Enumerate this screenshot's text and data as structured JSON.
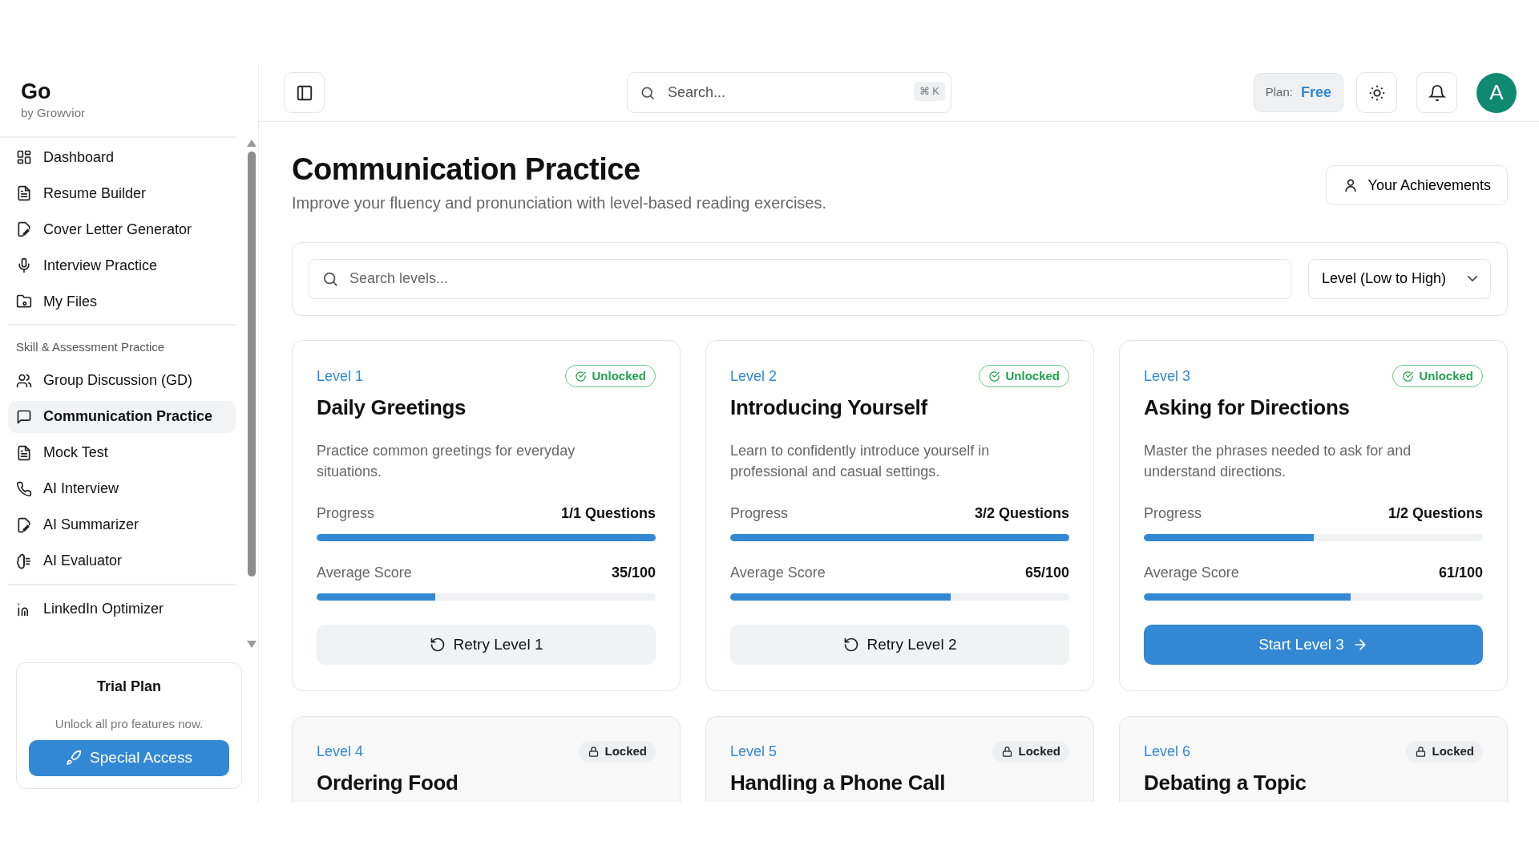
{
  "brand": {
    "name": "Go",
    "tagline": "by Growvior"
  },
  "sidebar": {
    "groups": [
      {
        "items": [
          {
            "label": "Dashboard",
            "selected": false
          },
          {
            "label": "Resume Builder",
            "selected": false
          },
          {
            "label": "Cover Letter Generator",
            "selected": false
          },
          {
            "label": "Interview Practice",
            "selected": false
          },
          {
            "label": "My Files",
            "selected": false
          }
        ]
      },
      {
        "heading": "Skill & Assessment Practice",
        "items": [
          {
            "label": "Group Discussion (GD)",
            "selected": false
          },
          {
            "label": "Communication Practice",
            "selected": true
          },
          {
            "label": "Mock Test",
            "selected": false
          },
          {
            "label": "AI Interview",
            "selected": false
          },
          {
            "label": "AI Summarizer",
            "selected": false
          },
          {
            "label": "AI Evaluator",
            "selected": false
          }
        ]
      },
      {
        "items": [
          {
            "label": "LinkedIn Optimizer",
            "selected": false
          }
        ]
      }
    ]
  },
  "trial": {
    "title": "Trial Plan",
    "text": "Unlock all pro features now.",
    "button": "Special Access"
  },
  "header": {
    "search": {
      "placeholder": "Search...",
      "shortcut": "⌘ K"
    },
    "plan": {
      "label": "Plan:",
      "value": "Free"
    },
    "avatar": "A"
  },
  "page": {
    "title": "Communication Practice",
    "subtitle": "Improve your fluency and pronunciation with level-based reading exercises.",
    "achievements_button": "Your Achievements",
    "search": {
      "placeholder": "Search levels..."
    },
    "sort": {
      "value": "Level (Low to High)"
    }
  },
  "levels": [
    {
      "level": "Level 1",
      "title": "Daily Greetings",
      "locked": false,
      "status_label": "Unlocked",
      "description": "Practice common greetings for everyday situations.",
      "progress": {
        "label": "Progress",
        "reading": "1/1 Questions",
        "level": 1
      },
      "score": {
        "label": "Average Score",
        "reading": "35/100",
        "level": 0.35
      },
      "action": {
        "kind": "retry",
        "label": "Retry Level 1"
      }
    },
    {
      "level": "Level 2",
      "title": "Introducing Yourself",
      "locked": false,
      "status_label": "Unlocked",
      "description": "Learn to confidently introduce yourself in professional and casual settings.",
      "progress": {
        "label": "Progress",
        "reading": "3/2 Questions",
        "level": 1
      },
      "score": {
        "label": "Average Score",
        "reading": "65/100",
        "level": 0.65
      },
      "action": {
        "kind": "retry",
        "label": "Retry Level 2"
      }
    },
    {
      "level": "Level 3",
      "title": "Asking for Directions",
      "locked": false,
      "status_label": "Unlocked",
      "description": "Master the phrases needed to ask for and understand directions.",
      "progress": {
        "label": "Progress",
        "reading": "1/2 Questions",
        "level": 0.5
      },
      "score": {
        "label": "Average Score",
        "reading": "61/100",
        "level": 0.61
      },
      "action": {
        "kind": "start",
        "label": "Start Level 3"
      }
    },
    {
      "level": "Level 4",
      "title": "Ordering Food",
      "locked": true,
      "status_label": "Locked"
    },
    {
      "level": "Level 5",
      "title": "Handling a Phone Call",
      "locked": true,
      "status_label": "Locked"
    },
    {
      "level": "Level 6",
      "title": "Debating a Topic",
      "locked": true,
      "status_label": "Locked"
    }
  ]
}
